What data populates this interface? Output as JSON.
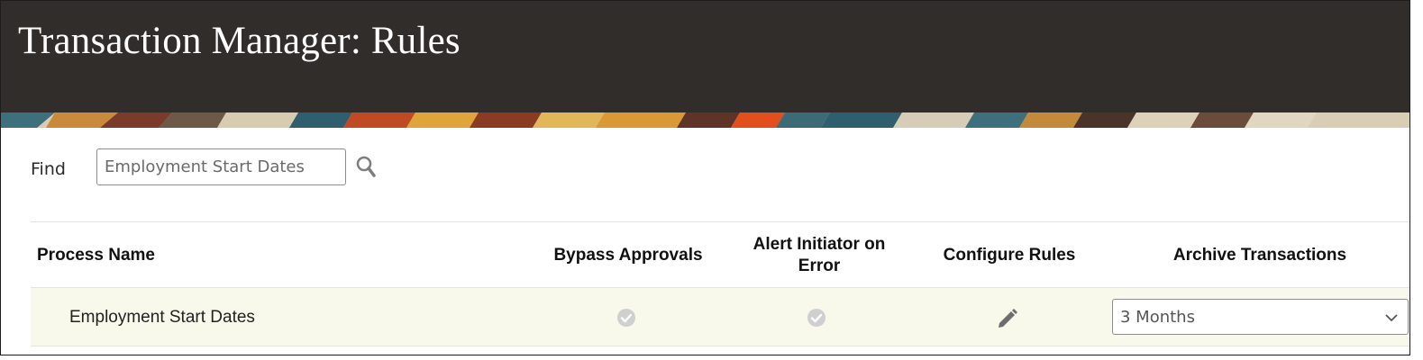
{
  "header": {
    "title": "Transaction Manager: Rules"
  },
  "search": {
    "label": "Find",
    "value": "Employment Start Dates",
    "placeholder": ""
  },
  "table": {
    "columns": [
      "Process Name",
      "Bypass Approvals",
      "Alert Initiator on",
      "Error",
      "Configure Rules",
      "Archive Transactions"
    ],
    "rows": [
      {
        "process_name": "Employment Start Dates",
        "bypass_approvals": true,
        "alert_initiator_on_error": true,
        "archive": "3 Months"
      }
    ]
  },
  "icons": {
    "search": "magnifier-icon",
    "check": "check-circle-icon",
    "edit": "pencil-icon",
    "dropdown": "chevron-down-icon"
  },
  "colors": {
    "header_bg": "#312d2a",
    "row_bg": "#f8f8eb"
  }
}
